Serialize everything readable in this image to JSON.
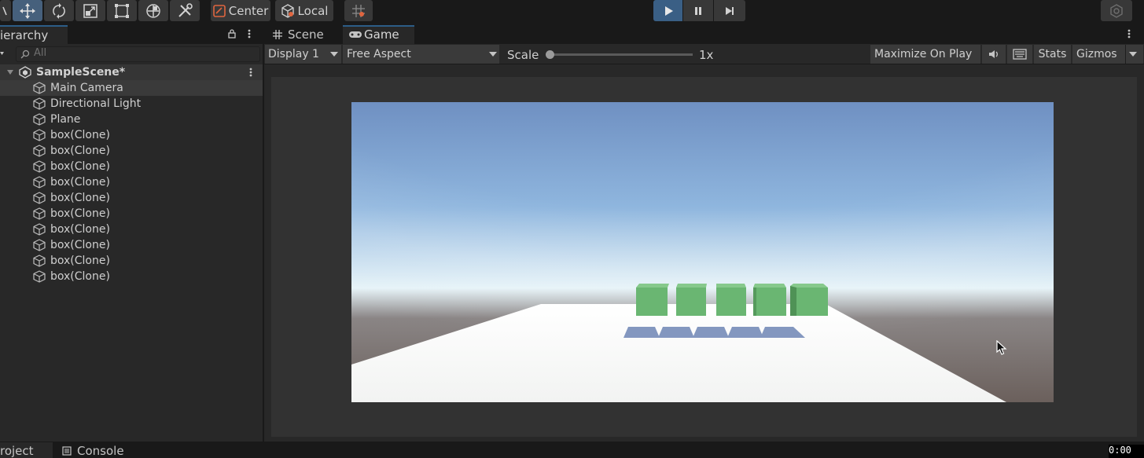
{
  "toolbar": {
    "pivot_label": "Center",
    "space_label": "Local"
  },
  "hierarchy": {
    "tab_label": "ierarchy",
    "search_placeholder": "All",
    "scene_name": "SampleScene*",
    "items": [
      {
        "label": "Main Camera"
      },
      {
        "label": "Directional Light"
      },
      {
        "label": "Plane"
      },
      {
        "label": "box(Clone)"
      },
      {
        "label": "box(Clone)"
      },
      {
        "label": "box(Clone)"
      },
      {
        "label": "box(Clone)"
      },
      {
        "label": "box(Clone)"
      },
      {
        "label": "box(Clone)"
      },
      {
        "label": "box(Clone)"
      },
      {
        "label": "box(Clone)"
      },
      {
        "label": "box(Clone)"
      },
      {
        "label": "box(Clone)"
      }
    ]
  },
  "game_view": {
    "tabs": [
      {
        "label": "Scene"
      },
      {
        "label": "Game"
      }
    ],
    "display": "Display 1",
    "aspect": "Free Aspect",
    "scale_label": "Scale",
    "scale_value": "1x",
    "maximize_label": "Maximize On Play",
    "stats_label": "Stats",
    "gizmos_label": "Gizmos"
  },
  "bottom": {
    "project_tab": "roject",
    "console_tab": "Console",
    "clock": "0:00"
  },
  "colors": {
    "accent": "#2c5d87",
    "play_active": "#3a5f85",
    "cube": "#6ab672",
    "sky_top": "#6f90c2",
    "horizon": "#e6f3f8",
    "ground": "#6b605c"
  }
}
